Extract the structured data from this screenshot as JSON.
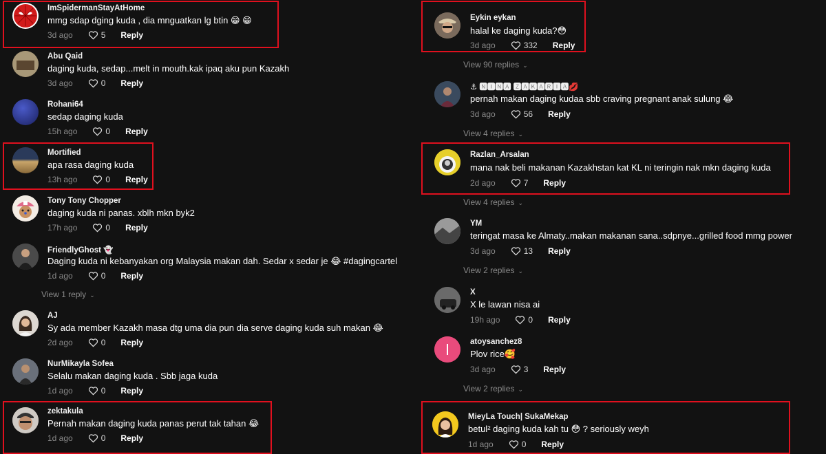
{
  "left_comments": [
    {
      "username": "ImSpidermanStayAtHome",
      "text": "mmg sdap dging kuda , dia mnguatkan lg btin 😁 😁",
      "time": "3d ago",
      "likes": "5",
      "reply": "Reply"
    },
    {
      "username": "Abu Qaid",
      "text": "daging kuda, sedap...melt in mouth.kak ipaq aku pun Kazakh",
      "time": "3d ago",
      "likes": "0",
      "reply": "Reply"
    },
    {
      "username": "Rohani64",
      "text": "sedap daging kuda",
      "time": "15h ago",
      "likes": "0",
      "reply": "Reply"
    },
    {
      "username": "Mortified",
      "text": "apa rasa daging kuda",
      "time": "13h ago",
      "likes": "0",
      "reply": "Reply"
    },
    {
      "username": "Tony Tony Chopper",
      "text": "daging kuda ni panas. xblh mkn byk2",
      "time": "17h ago",
      "likes": "0",
      "reply": "Reply"
    },
    {
      "username": "FriendlyGhost 👻",
      "text": "Daging kuda ni kebanyakan org Malaysia makan dah. Sedar x sedar je 😂 #dagingcartel",
      "time": "1d ago",
      "likes": "0",
      "reply": "Reply"
    },
    {
      "username": "AJ",
      "text": "Sy ada member Kazakh masa dtg uma dia pun dia serve daging kuda suh makan 😂",
      "time": "2d ago",
      "likes": "0",
      "reply": "Reply"
    },
    {
      "username": "NurMikayla Sofea",
      "text": "Selalu makan daging kuda . Sbb jaga kuda",
      "time": "1d ago",
      "likes": "0",
      "reply": "Reply"
    },
    {
      "username": "zektakula",
      "text": "Pernah makan daging kuda panas perut tak tahan 😂",
      "time": "1d ago",
      "likes": "0",
      "reply": "Reply"
    }
  ],
  "left_view_replies": [
    "View 1 reply"
  ],
  "right_comments": [
    {
      "username": "Eykin eykan",
      "text": "halal ke daging kuda?😳",
      "time": "3d ago",
      "likes": "332",
      "reply": "Reply"
    },
    {
      "username": "⚓ 🅽🅸🅽🅰 🆉🅰🅺🅰🆁🅸🅰💋",
      "text": "pernah makan daging kudaa sbb craving pregnant anak sulung 😂",
      "time": "3d ago",
      "likes": "56",
      "reply": "Reply"
    },
    {
      "username": "Razlan_Arsalan",
      "text": "mana nak beli makanan Kazakhstan kat KL ni teringin nak mkn daging kuda",
      "time": "2d ago",
      "likes": "7",
      "reply": "Reply"
    },
    {
      "username": "YM",
      "text": "teringat masa ke Almaty..makan makanan sana..sdpnye...grilled food mmg power",
      "time": "3d ago",
      "likes": "13",
      "reply": "Reply"
    },
    {
      "username": "X",
      "text": "X le lawan nisa ai",
      "time": "19h ago",
      "likes": "0",
      "reply": "Reply"
    },
    {
      "username": "atoysanchez8",
      "text": "Plov rice🥰",
      "time": "3d ago",
      "likes": "3",
      "reply": "Reply"
    },
    {
      "username": "MieyLa Touch| SukaMekap",
      "text": "betul² daging kuda kah tu 😳 ? seriously weyh",
      "time": "1d ago",
      "likes": "0",
      "reply": "Reply"
    }
  ],
  "right_view_replies": [
    "View 90 replies",
    "View 4 replies",
    "View 4 replies",
    "View 2 replies",
    "View 2 replies"
  ],
  "colors": {
    "background": "#121212",
    "highlight": "#e0101e",
    "muted": "#8a8a8a"
  },
  "icons": {
    "like": "heart-outline-icon",
    "expand": "chevron-down-icon"
  }
}
